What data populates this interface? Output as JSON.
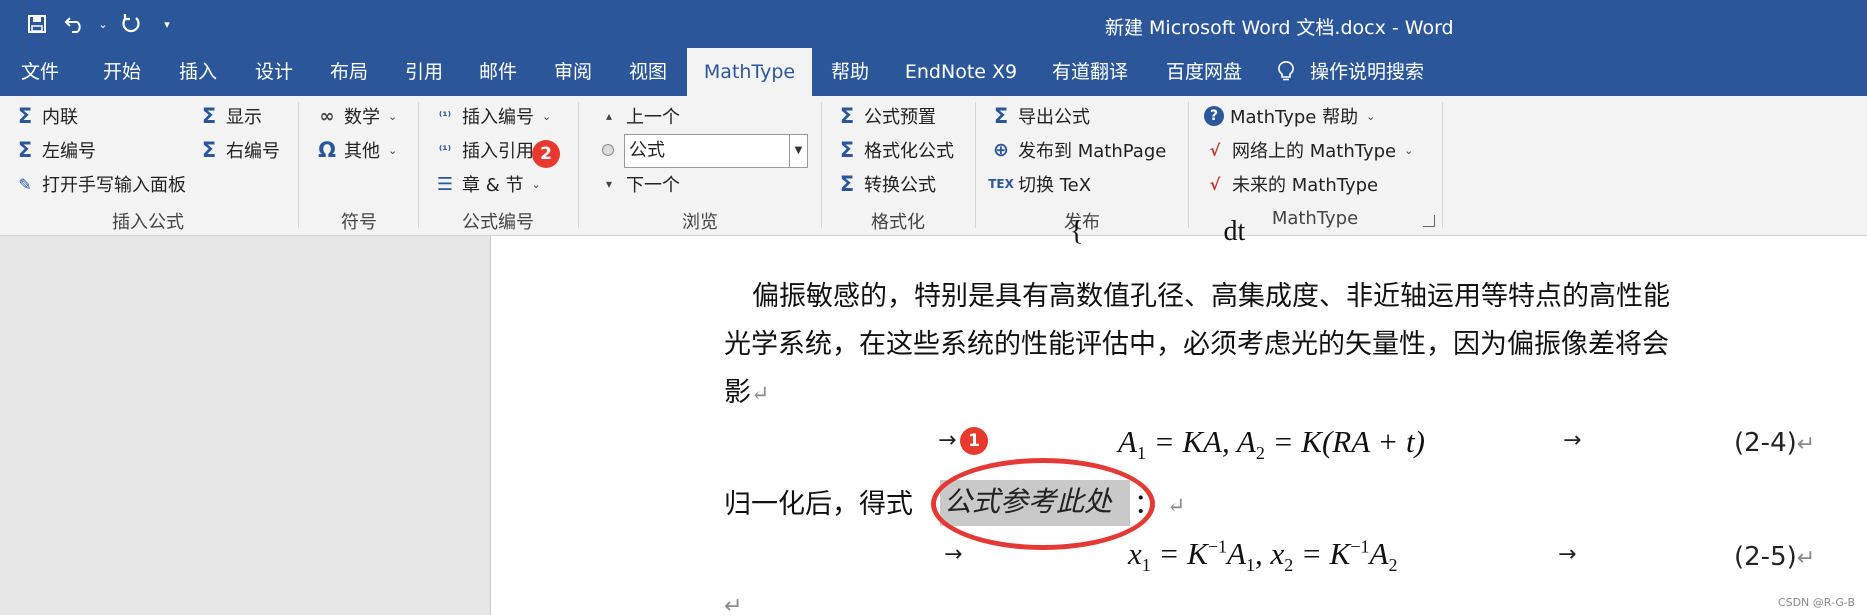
{
  "window": {
    "title": "新建 Microsoft Word 文档.docx  -  Word"
  },
  "quick_access": [
    {
      "name": "save-icon",
      "glyph": "🖫"
    },
    {
      "name": "undo-icon",
      "glyph": "↶"
    },
    {
      "name": "undo-dropdown-icon",
      "glyph": "⌄"
    },
    {
      "name": "redo-icon",
      "glyph": "↻"
    },
    {
      "name": "customize-icon",
      "glyph": "▾"
    }
  ],
  "tabs": [
    "文件",
    "开始",
    "插入",
    "设计",
    "布局",
    "引用",
    "邮件",
    "审阅",
    "视图",
    "MathType",
    "帮助",
    "EndNote X9",
    "有道翻译",
    "百度网盘",
    "操作说明搜索"
  ],
  "active_tab": "MathType",
  "ribbon": {
    "insert_formula": {
      "label": "插入公式",
      "inline": "内联",
      "display": "显示",
      "left_number": "左编号",
      "right_number": "右编号",
      "handwriting": "打开手写输入面板"
    },
    "symbols": {
      "label": "符号",
      "math": "数学",
      "other": "其他"
    },
    "formula_number": {
      "label": "公式编号",
      "insert_number": "插入编号",
      "insert_reference": "插入引用",
      "chapter_section": "章 & 节"
    },
    "browse": {
      "label": "浏览",
      "previous": "上一个",
      "combo_value": "公式",
      "next": "下一个"
    },
    "format": {
      "label": "格式化",
      "presets": "公式预置",
      "format_equations": "格式化公式",
      "convert": "转换公式"
    },
    "publish": {
      "label": "发布",
      "export": "导出公式",
      "publish_mathpage": "发布到 MathPage",
      "toggle_tex": "切换 TeX"
    },
    "mathtype": {
      "label": "MathType",
      "help": "MathType 帮助",
      "online": "网络上的 MathType",
      "future": "未来的 MathType"
    }
  },
  "badges": {
    "one": "1",
    "two": "2"
  },
  "document": {
    "top_fragment": "dt",
    "para_line1": "偏振敏感的，特别是具有高数值孔径、高集成度、非近轴运用等特点的高性能",
    "para_line2": "光学系统，在这些系统的性能评估中，必须考虑光的矢量性，因为偏振像差将会",
    "para_line3": "影",
    "paragraph_mark": "↵",
    "tab_arrow": "→",
    "eq1_num": "(2-4)",
    "eq2_num": "(2-5)",
    "norm_prefix": "归一化后，得式",
    "reference_placeholder": "公式参考此处",
    "norm_suffix": "："
  },
  "watermark": "CSDN @R-G-B",
  "colors": {
    "accent": "#2b579a",
    "annotation": "#e53935"
  }
}
